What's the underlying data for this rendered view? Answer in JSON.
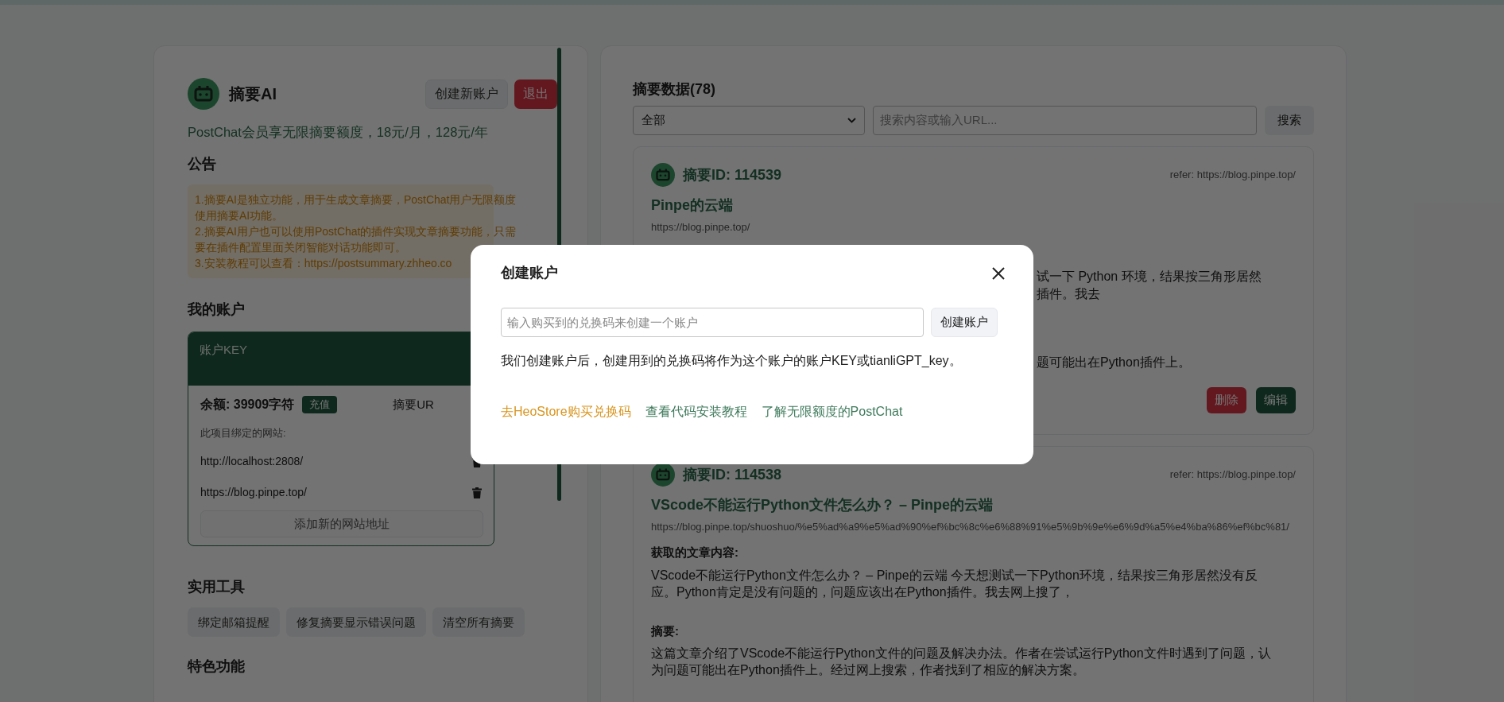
{
  "sidebar": {
    "app_name": "摘要AI",
    "header_buttons": [
      {
        "label": "创建新账户",
        "kind": "secondary"
      },
      {
        "label": "退出",
        "kind": "danger"
      }
    ],
    "promo": "PostChat会员享无限摘要额度，18元/月，128元/年",
    "notice": {
      "heading": "公告",
      "paragraphs": [
        [
          "1.摘要AI是独立功能，用于生成文章摘要，PostChat用户无限额度",
          "使用摘要AI功能。"
        ],
        [
          "2.摘要AI用户也可以使用PostChat的插件实现文章摘要功能，只需",
          "要在插件配置里面关闭智能对话功能即可。"
        ],
        [
          "3.安装教程可以查看：https://postsummary.zhheo.co"
        ]
      ]
    },
    "account": {
      "heading": "我的账户",
      "key_label": "账户KEY",
      "balance": "余额: 39909字符",
      "recharge": "充值",
      "summary_url_label": "摘要UR",
      "sites_label": "此项目绑定的网站:",
      "sites": [
        "http://localhost:2808/",
        "https://blog.pinpe.top/"
      ],
      "add_site": "添加新的网站地址"
    },
    "tools": {
      "heading": "实用工具",
      "buttons": [
        "绑定邮箱提醒",
        "修复摘要显示错误问题",
        "清空所有摘要"
      ]
    },
    "features": {
      "heading": "特色功能"
    }
  },
  "main": {
    "heading": "摘要数据(78)",
    "filter": {
      "value": "全部"
    },
    "search": {
      "placeholder": "搜索内容或输入URL...",
      "button": "搜索"
    },
    "cards": [
      {
        "kind": "partial",
        "id": "摘要ID: 114539",
        "refer": "refer: https://blog.pinpe.top/",
        "title": "Pinpe的云端",
        "url": "https://blog.pinpe.top/",
        "fragments": [
          "试一下 Python 环境，结果按三角形居然",
          "插件。我去",
          "题可能出在Python插件上。"
        ],
        "actions": [
          {
            "label": "删除",
            "kind": "danger"
          },
          {
            "label": "编辑",
            "kind": "primary"
          }
        ]
      },
      {
        "kind": "full",
        "id": "摘要ID: 114538",
        "refer": "refer: https://blog.pinpe.top/",
        "title": "VScode不能运行Python文件怎么办？ – Pinpe的云端",
        "url": "https://blog.pinpe.top/shuoshuo/%e5%ad%a9%e5%ad%90%ef%bc%8c%e6%88%91%e5%9b%9e%e6%9d%a5%e4%ba%86%ef%bc%81/",
        "content_label": "获取的文章内容:",
        "content": "VScode不能运行Python文件怎么办？ – Pinpe的云端 今天想测试一下Python环境，结果按三角形居然没有反应。Python肯定是没有问题的，问题应该出在Python插件。我去网上搜了，",
        "summary_label": "摘要:",
        "summary": "这篇文章介绍了VScode不能运行Python文件的问题及解决办法。作者在尝试运行Python文件时遇到了问题，认为问题可能出在Python插件上。经过网上搜索，作者找到了相应的解决方案。"
      }
    ]
  },
  "dialog": {
    "title": "创建账户",
    "input_placeholder": "输入购买到的兑换码来创建一个账户",
    "submit": "创建账户",
    "note": "我们创建账户后，创建用到的兑换码将作为这个账户的账户KEY或tianliGPT_key。",
    "links": [
      {
        "label": "去HeoStore购买兑换码",
        "kind": "store"
      },
      {
        "label": "查看代码安装教程",
        "kind": "info"
      },
      {
        "label": "了解无限额度的PostChat",
        "kind": "info"
      }
    ]
  }
}
